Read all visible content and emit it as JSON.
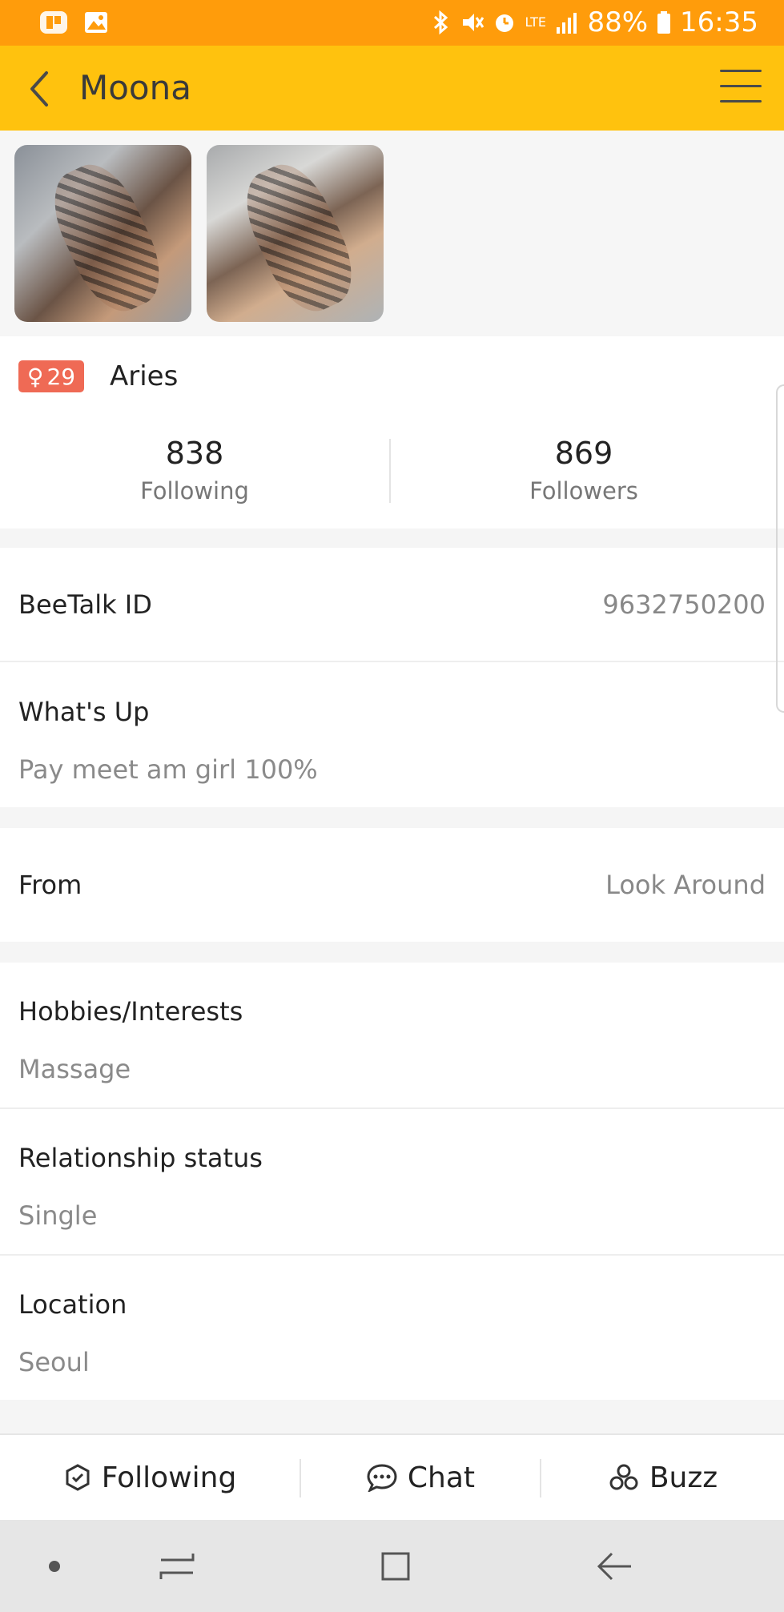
{
  "status_bar": {
    "battery": "88%",
    "time": "16:35",
    "network": "LTE",
    "icons": [
      "office-icon",
      "gallery-icon",
      "bluetooth-icon",
      "mute-icon",
      "alarm-icon",
      "signal-icon",
      "battery-icon"
    ]
  },
  "app_bar": {
    "title": "Moona",
    "back_icon": "chevron-left-icon",
    "menu_icon": "hamburger-menu-icon",
    "color": "#ffc20e"
  },
  "photos": [
    "photo-1",
    "photo-2"
  ],
  "profile": {
    "gender_symbol": "♀",
    "age": "29",
    "zodiac": "Aries",
    "following_count": "838",
    "following_label": "Following",
    "followers_count": "869",
    "followers_label": "Followers"
  },
  "details": {
    "beetalk_id_label": "BeeTalk ID",
    "beetalk_id_value": "9632750200",
    "whats_up_label": "What's Up",
    "whats_up_value": "Pay meet am girl 100%",
    "from_label": "From",
    "from_value": "Look Around",
    "hobbies_label": "Hobbies/Interests",
    "hobbies_value": "Massage",
    "relationship_label": "Relationship status",
    "relationship_value": "Single",
    "location_label": "Location",
    "location_value": "Seoul"
  },
  "actions": {
    "following": "Following",
    "chat": "Chat",
    "buzz": "Buzz"
  },
  "colors": {
    "status_bar": "#ff9c0b",
    "badge": "#ef6a55"
  }
}
